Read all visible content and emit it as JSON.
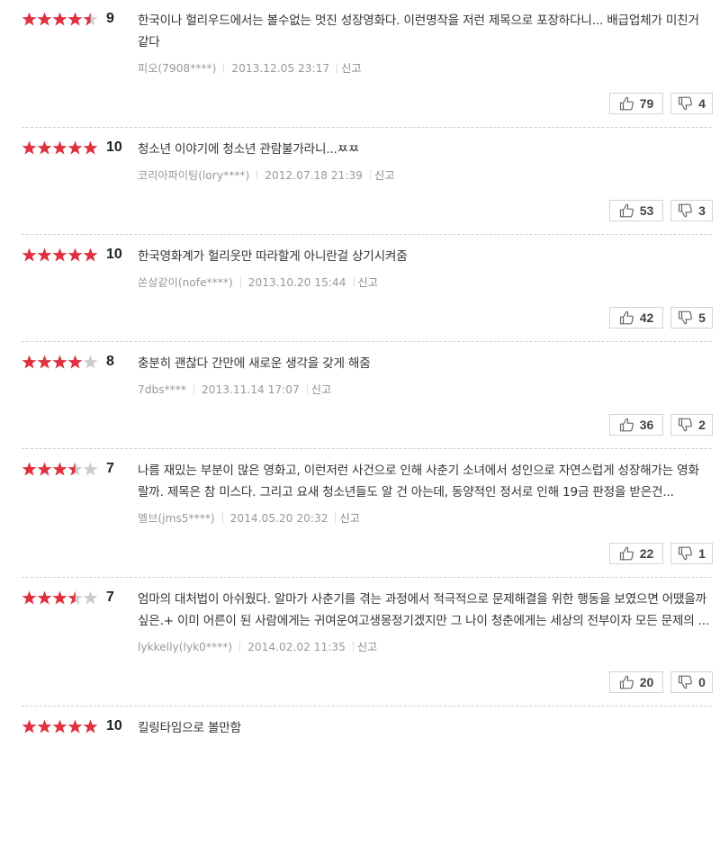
{
  "reviews": [
    {
      "stars": 4.5,
      "score": "9",
      "text": "한국이나 헐리우드에서는 볼수없는 멋진 성장영화다. 이런명작을 저런 제목으로 포장하다니... 배급업체가 미친거같다",
      "author": "피오(7908****)",
      "date": "2013.12.05 23:17",
      "report": "신고",
      "up": "79",
      "down": "4"
    },
    {
      "stars": 5,
      "score": "10",
      "text": "청소년 이야기에 청소년 관람불가라니...ㅉㅉ",
      "author": "코리아파이팅(lory****)",
      "date": "2012.07.18 21:39",
      "report": "신고",
      "up": "53",
      "down": "3"
    },
    {
      "stars": 5,
      "score": "10",
      "text": "한국영화계가 헐리웃만 따라할게 아니란걸 상기시켜줌",
      "author": "쏜살같이(nofe****)",
      "date": "2013.10.20 15:44",
      "report": "신고",
      "up": "42",
      "down": "5"
    },
    {
      "stars": 4,
      "score": "8",
      "text": "충분히 괜찮다 간만에 새로운 생각을 갖게 해줌",
      "author": "7dbs****",
      "date": "2013.11.14 17:07",
      "report": "신고",
      "up": "36",
      "down": "2"
    },
    {
      "stars": 3.5,
      "score": "7",
      "text": "나름 재밌는 부분이 많은 영화고, 이런저런 사건으로 인해 사춘기 소녀에서 성인으로 자연스럽게 성장해가는 영화랄까. 제목은 참 미스다. 그리고 요새 청소년들도 알 건 아는데, 동양적인 정서로 인해 19금 판정을 받은건...",
      "author": "멜브(jms5****)",
      "date": "2014.05.20 20:32",
      "report": "신고",
      "up": "22",
      "down": "1"
    },
    {
      "stars": 3.5,
      "score": "7",
      "text": "엄마의 대처법이 아쉬웠다. 알마가 사춘기를 겪는 과정에서 적극적으로 문제해결을 위한 행동을 보였으면 어땠을까싶은.+ 이미 어른이 된 사람에게는 귀여운여고생몽정기겠지만 그 나이 청춘에게는 세상의 전부이자 모든 문제의 ...",
      "author": "lykkelly(lyk0****)",
      "date": "2014.02.02 11:35",
      "report": "신고",
      "up": "20",
      "down": "0"
    },
    {
      "stars": 5,
      "score": "10",
      "text": "킬링타임으로 볼만함",
      "author": "",
      "date": "",
      "report": "",
      "up": "",
      "down": ""
    }
  ],
  "colors": {
    "star_on": "#e0303e",
    "star_off": "#cccccc"
  },
  "icons": {
    "up": "thumbs-up-icon",
    "down": "thumbs-down-icon"
  }
}
